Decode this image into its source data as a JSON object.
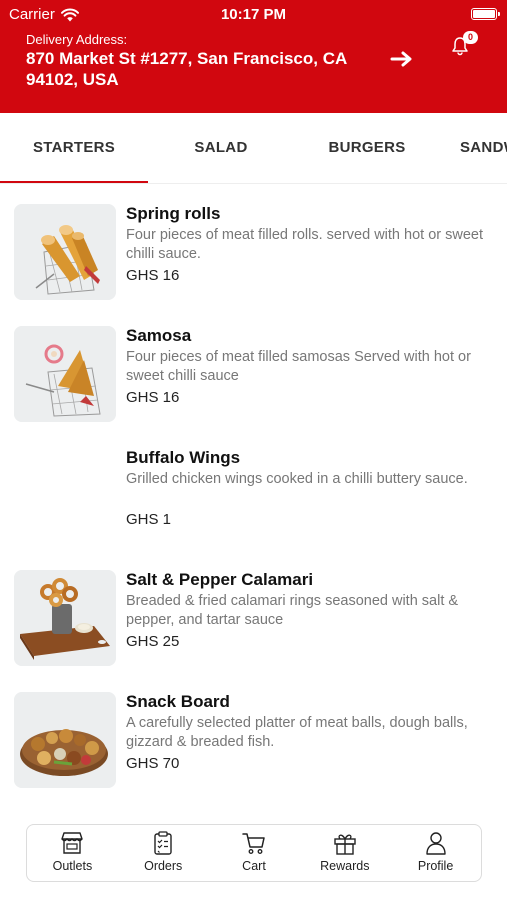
{
  "status_bar": {
    "carrier": "Carrier",
    "time": "10:17 PM"
  },
  "header": {
    "address_label": "Delivery Address:",
    "address": "870 Market St #1277, San Francisco, CA 94102, USA",
    "notification_count": "0",
    "accent_color": "#d1070f"
  },
  "tabs": [
    {
      "label": "STARTERS",
      "active": true
    },
    {
      "label": "SALAD",
      "active": false
    },
    {
      "label": "BURGERS",
      "active": false
    },
    {
      "label": "SANDWICHES",
      "active": false
    }
  ],
  "menu_items": [
    {
      "name": "Spring rolls",
      "description": "Four pieces of meat filled rolls.  served with hot or sweet chilli  sauce.",
      "price": "GHS 16",
      "image": "spring-rolls-basket"
    },
    {
      "name": "Samosa",
      "description": "Four pieces of meat filled samosas Served with hot or sweet chilli sauce",
      "price": "GHS 16",
      "image": "samosa-basket"
    },
    {
      "name": "Buffalo Wings",
      "description": "Grilled chicken wings cooked in a chilli buttery sauce.",
      "price": "GHS 1",
      "image": ""
    },
    {
      "name": "Salt & Pepper Calamari",
      "description": "Breaded & fried calamari rings seasoned with salt & pepper, and  tartar sauce",
      "price": "GHS 25",
      "image": "calamari-board"
    },
    {
      "name": "Snack Board",
      "description": "A carefully selected platter of meat balls, dough balls, gizzard & breaded fish.",
      "price": "GHS 70",
      "image": "snack-platter"
    }
  ],
  "bottom_nav": [
    {
      "label": "Outlets",
      "icon": "store-icon"
    },
    {
      "label": "Orders",
      "icon": "clipboard-icon"
    },
    {
      "label": "Cart",
      "icon": "cart-icon"
    },
    {
      "label": "Rewards",
      "icon": "gift-icon"
    },
    {
      "label": "Profile",
      "icon": "person-icon"
    }
  ]
}
